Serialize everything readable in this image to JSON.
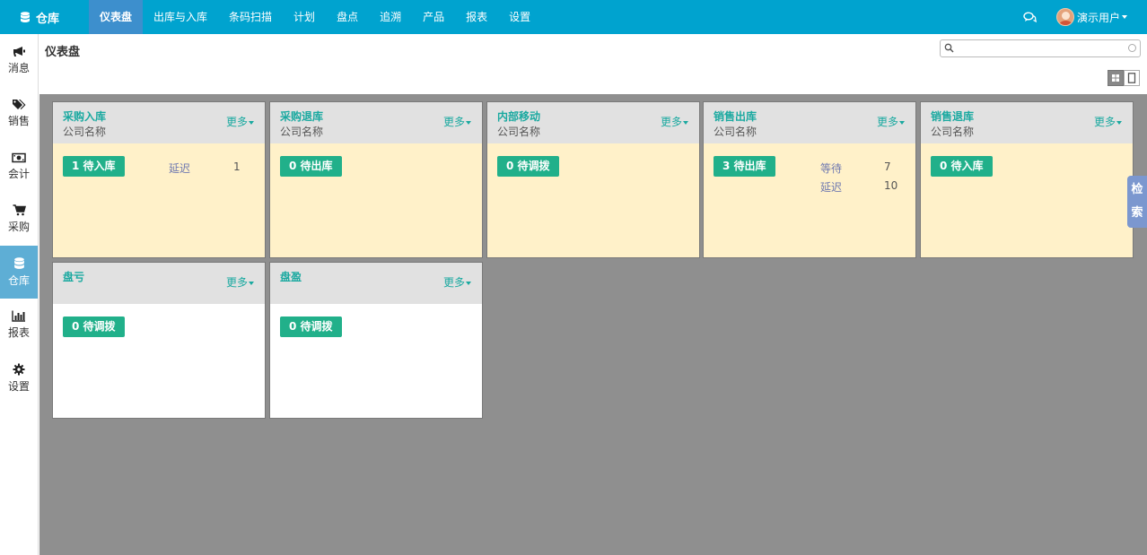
{
  "brand": {
    "label": "仓库"
  },
  "topnav": {
    "items": [
      {
        "label": "仪表盘",
        "active": true
      },
      {
        "label": "出库与入库"
      },
      {
        "label": "条码扫描"
      },
      {
        "label": "计划"
      },
      {
        "label": "盘点"
      },
      {
        "label": "追溯"
      },
      {
        "label": "产品"
      },
      {
        "label": "报表"
      },
      {
        "label": "设置"
      }
    ]
  },
  "user": {
    "name": "演示用户"
  },
  "sidebar": {
    "items": [
      {
        "label": "消息",
        "icon": "bullhorn-icon"
      },
      {
        "label": "销售",
        "icon": "tags-icon"
      },
      {
        "label": "会计",
        "icon": "money-icon"
      },
      {
        "label": "采购",
        "icon": "cart-icon"
      },
      {
        "label": "仓库",
        "icon": "database-icon",
        "active": true
      },
      {
        "label": "报表",
        "icon": "bar-chart-icon"
      },
      {
        "label": "设置",
        "icon": "gear-icon"
      }
    ]
  },
  "header": {
    "title": "仪表盘",
    "search_placeholder": ""
  },
  "cards": [
    {
      "title": "采购入库",
      "subtitle": "公司名称",
      "more": "更多",
      "button": "1 待入库",
      "stats": [
        {
          "label": "延迟",
          "value": "1"
        }
      ]
    },
    {
      "title": "采购退库",
      "subtitle": "公司名称",
      "more": "更多",
      "button": "0 待出库",
      "stats": []
    },
    {
      "title": "内部移动",
      "subtitle": "公司名称",
      "more": "更多",
      "button": "0 待调拨",
      "stats": []
    },
    {
      "title": "销售出库",
      "subtitle": "公司名称",
      "more": "更多",
      "button": "3 待出库",
      "stats": [
        {
          "label": "等待",
          "value": "7"
        },
        {
          "label": "延迟",
          "value": "10"
        }
      ]
    },
    {
      "title": "销售退库",
      "subtitle": "公司名称",
      "more": "更多",
      "button": "0 待入库",
      "stats": []
    },
    {
      "title": "盘亏",
      "subtitle": "",
      "more": "更多",
      "button": "0 待调拨",
      "stats": []
    },
    {
      "title": "盘盈",
      "subtitle": "",
      "more": "更多",
      "button": "0 待调拨",
      "stats": []
    }
  ],
  "side_tab": {
    "chars": [
      "检",
      "索"
    ]
  },
  "colors": {
    "topbar": "#00a3cf",
    "active_nav": "#3d8fcd",
    "accent": "#1aa9a0",
    "button": "#21b08a",
    "card_body": "#fff1c9",
    "main_bg": "#8f8f8f"
  }
}
